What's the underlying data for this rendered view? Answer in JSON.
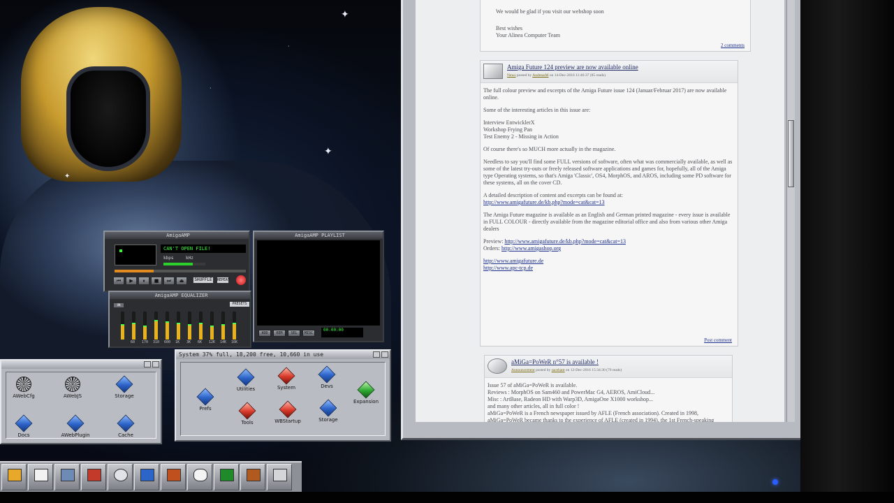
{
  "amigaamp": {
    "main_title": "AmigaAMP",
    "track_text": "CAN'T OPEN FILE!",
    "kbps_label": "kbps",
    "khz_label": "kHz",
    "shuffle_label": "SHUFFLE",
    "repeat_label": "REPEAT",
    "buttons": [
      "⏮",
      "▶",
      "⏸",
      "■",
      "⏭",
      "⏏"
    ],
    "eq_title": "AmigaAMP EQUALIZER",
    "eq_on_label": "ON",
    "eq_preset_label": "PRESETS",
    "eq_freqs": [
      "60",
      "170",
      "310",
      "600",
      "1K",
      "3K",
      "6K",
      "12K",
      "14K",
      "16K"
    ],
    "eq_levels": [
      0.55,
      0.6,
      0.5,
      0.7,
      0.65,
      0.6,
      0.55,
      0.6,
      0.5,
      0.55,
      0.6
    ],
    "playlist_title": "AmigaAMP PLAYLIST",
    "playlist_buttons": [
      "ADD",
      "REM",
      "SEL",
      "MISC"
    ],
    "playlist_time": "00:00:00"
  },
  "system_drawer": {
    "title": "System 37% full, 18,200 free, 10,660 in use",
    "icons": [
      {
        "label": "Prefs",
        "kind": "blue"
      },
      {
        "label": "Utilities",
        "kind": "blue"
      },
      {
        "label": "System",
        "kind": "red"
      },
      {
        "label": "Devs",
        "kind": "blue"
      },
      {
        "label": "Expansion",
        "kind": "green"
      },
      {
        "label": "Tools",
        "kind": "red"
      },
      {
        "label": "WBStartup",
        "kind": "red"
      },
      {
        "label": "Storage",
        "kind": "blue"
      }
    ]
  },
  "left_drawer": {
    "icons": [
      {
        "label": "AWebCfg",
        "kind": "web"
      },
      {
        "label": "AWebJS",
        "kind": "web"
      },
      {
        "label": "Storage",
        "kind": "blue"
      },
      {
        "label": "Docs",
        "kind": "blue"
      },
      {
        "label": "AWebPlugin",
        "kind": "blue"
      },
      {
        "label": "Cache",
        "kind": "blue"
      }
    ]
  },
  "dock": {
    "items": [
      "",
      "",
      "",
      "",
      "",
      "",
      "",
      "",
      "",
      "",
      ""
    ]
  },
  "browser": {
    "post1": {
      "lines": [
        "We would be glad if you visit our webshop soon",
        "Best wishes",
        "Your Alinea Computer Team"
      ],
      "comments": "2 comments"
    },
    "post2": {
      "title": "Amiga Future 124 preview are now available online",
      "category": "News",
      "meta_posted": "posted by",
      "author": "AndreasM",
      "date": "on 14-Dec-2016 11:46:37 (85 reads)",
      "intro": "The full colour preview and excerpts of the Amiga Future issue 124 (Januar/Februar 2017) are now available online.",
      "some_articles": "Some of the interesting articles in this issue are:",
      "articles": [
        "Interview EntwicklerX",
        "Workshop Frying Pan",
        "Test Enemy 2 - Missing in Action"
      ],
      "more": "Of course there's so MUCH more actually in the magazine.",
      "needless": "Needless to say you'll find some FULL versions of software, often what was commercially available, as well as some of the latest try-outs or freely released software applications and games for, hopefully, all of the Amiga type Operating systems, so that's Amiga 'Classic', OS4, MorphOS, and AROS, including some PD software for these systems, all on the cover CD.",
      "detailed": "A detailed description of content and excerpts can be found at:",
      "detailed_link": "http://www.amigafuture.de/kb.php?mode=cat&cat=13",
      "magazine": "The Amiga Future magazine is available as an English and German printed magazine - every issue is available in FULL COLOUR - directly available from the magazine editorial office and also from various other Amiga dealers",
      "preview_label": "Preview:",
      "preview_link": "http://www.amigafuture.de/kb.php?mode=cat&cat=13",
      "orders_label": "Orders:",
      "orders_link": "http://www.amigashop.org",
      "link1": "http://www.amigafuture.de",
      "link2": "http://www.apc-tcp.de",
      "post_comment": "Post comment"
    },
    "post3": {
      "title": "aMiGa=PoWeR n°57 is available !",
      "category": "Announcement",
      "meta_posted": "posted by",
      "author": "sacehant",
      "date": "on 12-Dec-2016 15:34:30 (79 reads)",
      "lines": [
        "Issue 57 of aMiGa=PoWeR is available.",
        "Reviews : MorphOS on Sam460 and PowerMac G4, AEROS, AmiCloud...",
        "Misc : ArtBase, Radeon HD with Warp3D, AmigaOne X1000 workshop...",
        "and many other articles, all in full color !",
        "aMiGa=PoWeR is a French newspaper issued by AFLE (French association). Created in 1998, aMiGa=PoWeR became thanks to the experience of AFLE (created in 1994), the 1st French-speaking Amiga newspaper. Entirely laser printed, aMiGa=PoWeR is distributed in"
      ]
    }
  },
  "colors": {
    "amp_green": "#3cff3c",
    "link_blue": "#1c2f8a",
    "workbench_grey": "#b4b8be",
    "power_led": "#2a5cff"
  }
}
